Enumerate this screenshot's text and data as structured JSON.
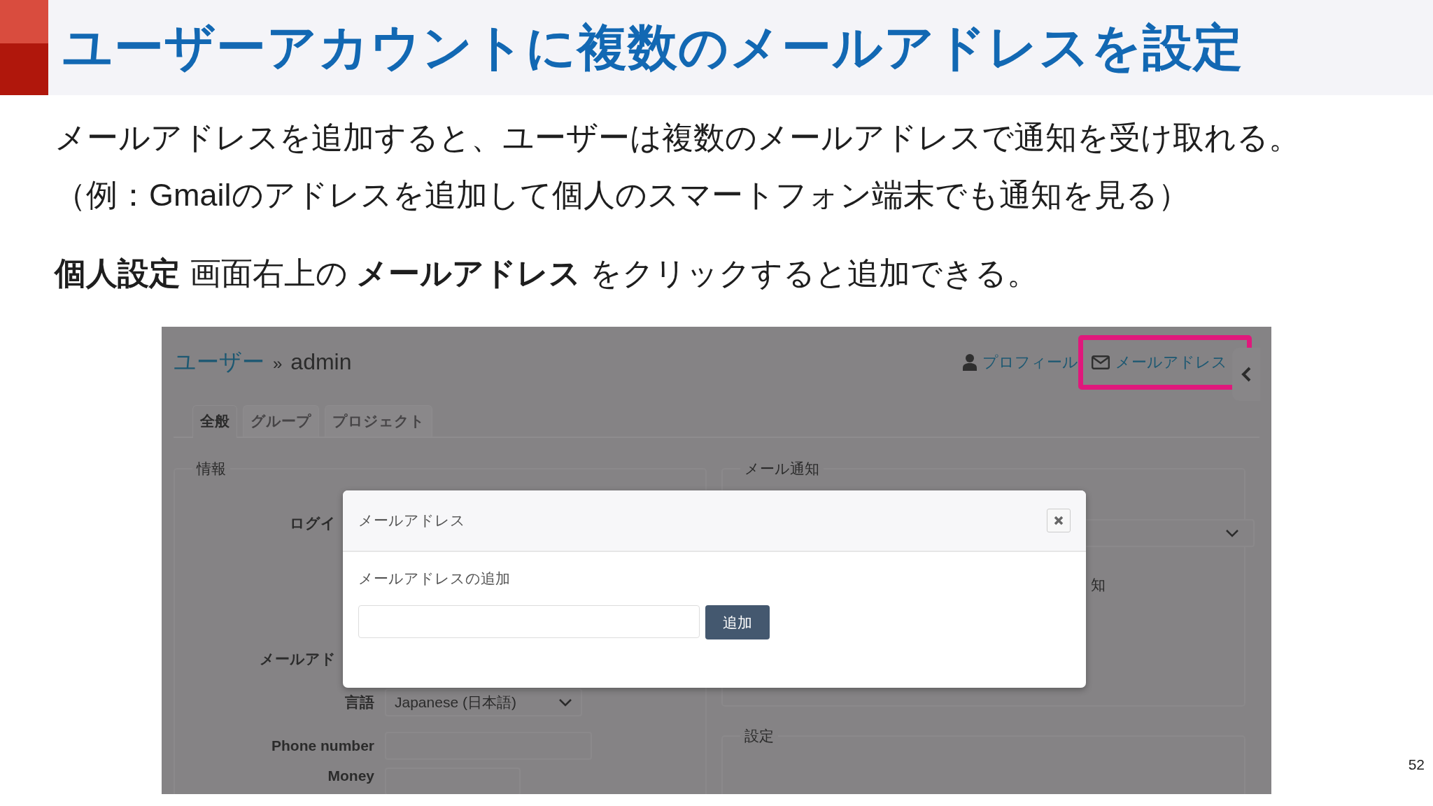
{
  "slide": {
    "title": "ユーザーアカウントに複数のメールアドレスを設定",
    "paragraphs": [
      "メールアドレスを追加すると、ユーザーは複数のメールアドレスで通知を受け取れる。",
      "（例：Gmailのアドレスを追加して個人のスマートフォン端末でも通知を見る）",
      "**個人設定** 画面右上の **メールアドレス** をクリックすると追加できる。"
    ],
    "page_number": "52"
  },
  "screenshot": {
    "breadcrumb": {
      "parent": "ユーザー",
      "separator": "»",
      "current": "admin"
    },
    "header_links": [
      {
        "label": "プロフィール",
        "highlighted": false
      },
      {
        "label": "メールアドレス",
        "highlighted": true
      }
    ],
    "tabs": [
      {
        "label": "全般",
        "selected": true
      },
      {
        "label": "グループ",
        "selected": false
      },
      {
        "label": "プロジェクト",
        "selected": false
      }
    ],
    "info_fieldset": {
      "legend": "情報",
      "rows": [
        {
          "kind": "covered",
          "label": "ログイ"
        },
        {
          "kind": "covered",
          "label": "メールアド"
        },
        {
          "kind": "select",
          "label": "言語",
          "value": "Japanese (日本語)"
        },
        {
          "kind": "input",
          "label": "Phone number"
        },
        {
          "kind": "input_short",
          "label": "Money"
        }
      ]
    },
    "mail_fieldset": {
      "legend": "メール通知",
      "partial_text": "知"
    },
    "prefs_fieldset": {
      "legend": "設定"
    },
    "modal": {
      "title": "メールアドレス",
      "field_label": "メールアドレスの追加",
      "add_button": "追加"
    }
  }
}
